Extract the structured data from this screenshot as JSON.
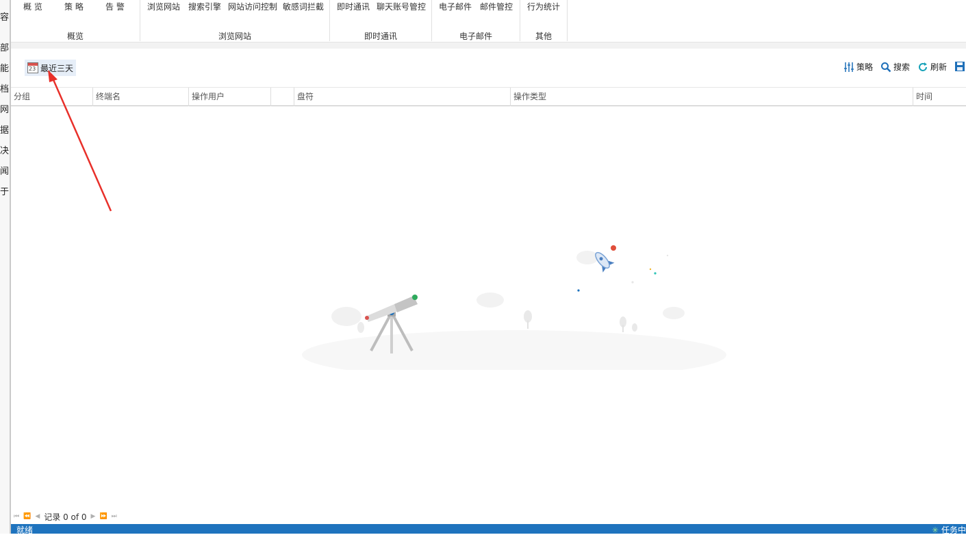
{
  "left_strip": [
    "容",
    "部",
    "能",
    "档",
    "网",
    "据",
    "决",
    "闻",
    "于"
  ],
  "ribbon": {
    "groups": [
      {
        "label": "概览",
        "buttons": [
          "概 览",
          "策 略",
          "告 警"
        ]
      },
      {
        "label": "浏览网站",
        "buttons": [
          "浏览网站",
          "搜索引擎",
          "网站访问控制",
          "敏感词拦截"
        ]
      },
      {
        "label": "即时通讯",
        "buttons": [
          "即时通讯",
          "聊天账号管控"
        ]
      },
      {
        "label": "电子邮件",
        "buttons": [
          "电子邮件",
          "邮件管控"
        ]
      },
      {
        "label": "其他",
        "buttons": [
          "行为统计"
        ]
      }
    ]
  },
  "toolbar": {
    "date_range": "最近三天",
    "calendar_day": "23",
    "policy": "策略",
    "search": "搜索",
    "refresh": "刷新"
  },
  "table": {
    "columns": [
      "分组",
      "终端名",
      "操作用户",
      "",
      "盘符",
      "操作类型",
      "时间"
    ],
    "rows": []
  },
  "pager": {
    "text": "记录 0 of 0"
  },
  "status": {
    "left": "就绪",
    "right": "任务中"
  },
  "colors": {
    "status_bar": "#1e73be",
    "date_button_bg": "#e6eef8",
    "annotation_arrow": "#e8302a"
  }
}
